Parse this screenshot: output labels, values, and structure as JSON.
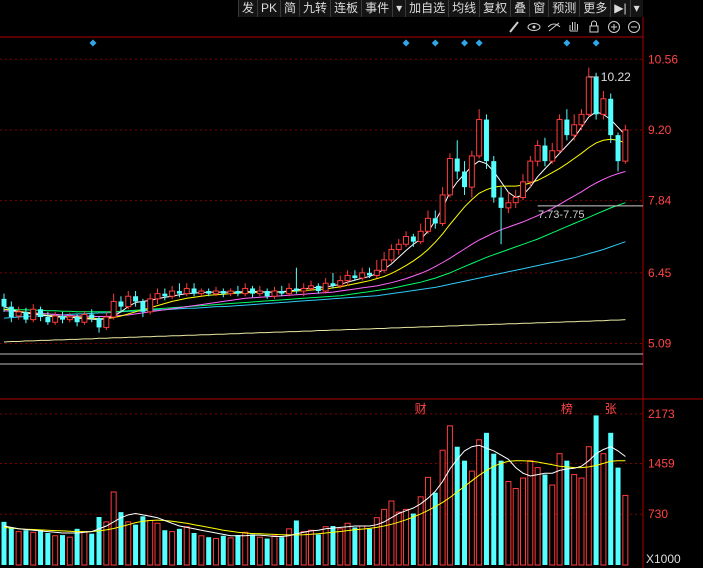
{
  "toolbar": {
    "items": [
      "发",
      "PK",
      "简",
      "九转",
      "连板",
      "事件",
      "▾",
      "加自选",
      "均线",
      "复权",
      "叠",
      "窗",
      "预测",
      "更多"
    ]
  },
  "colors": {
    "up": "#ff3b3b",
    "down": "#54ffff",
    "grid": "#7a0000",
    "ma5": "#ffffff",
    "ma10": "#ffff00",
    "ma20": "#ff66ff",
    "ma30": "#00ff66",
    "ma60": "#2ecbf5",
    "ma120": "#e8e8a0",
    "axis_text": "#ff4444",
    "marker": "#2fa6e8"
  },
  "chart_data": {
    "type": "candlestick",
    "price_axis": {
      "ticks": [
        10.56,
        9.2,
        7.84,
        6.45,
        5.09
      ],
      "ylim": [
        4.6,
        10.95
      ]
    },
    "volume_axis": {
      "ticks": [
        2173,
        1459,
        730
      ],
      "unit_label": "X1000",
      "ylim": [
        0,
        2300
      ]
    },
    "high_label": "10.22",
    "range_label": "7.73-7.75",
    "reference_line": 7.74,
    "event_flags": [
      {
        "index": 57,
        "text": "财"
      },
      {
        "index": 77,
        "text": "榜"
      },
      {
        "index": 83,
        "text": "张"
      }
    ],
    "markers": [
      16,
      55,
      59,
      63,
      65,
      77,
      81
    ],
    "candles": [
      [
        5.95,
        5.8,
        6.05,
        5.7,
        620
      ],
      [
        5.8,
        5.6,
        5.9,
        5.5,
        540
      ],
      [
        5.62,
        5.7,
        5.8,
        5.55,
        480
      ],
      [
        5.7,
        5.55,
        5.78,
        5.48,
        500
      ],
      [
        5.55,
        5.75,
        5.85,
        5.5,
        470
      ],
      [
        5.75,
        5.6,
        5.8,
        5.52,
        510
      ],
      [
        5.6,
        5.5,
        5.7,
        5.45,
        460
      ],
      [
        5.5,
        5.62,
        5.7,
        5.45,
        420
      ],
      [
        5.62,
        5.55,
        5.7,
        5.48,
        430
      ],
      [
        5.55,
        5.6,
        5.68,
        5.5,
        400
      ],
      [
        5.6,
        5.5,
        5.65,
        5.42,
        520
      ],
      [
        5.5,
        5.65,
        5.72,
        5.45,
        480
      ],
      [
        5.65,
        5.58,
        5.75,
        5.5,
        450
      ],
      [
        5.58,
        5.4,
        5.62,
        5.3,
        690
      ],
      [
        5.4,
        5.6,
        5.7,
        5.35,
        620
      ],
      [
        5.6,
        5.9,
        6.05,
        5.55,
        1050
      ],
      [
        5.9,
        5.8,
        6.0,
        5.7,
        760
      ],
      [
        5.8,
        6.0,
        6.1,
        5.75,
        620
      ],
      [
        6.0,
        5.9,
        6.1,
        5.8,
        580
      ],
      [
        5.9,
        5.7,
        5.95,
        5.6,
        700
      ],
      [
        5.7,
        5.95,
        6.05,
        5.65,
        640
      ],
      [
        5.95,
        6.05,
        6.15,
        5.85,
        600
      ],
      [
        6.05,
        6.0,
        6.15,
        5.92,
        500
      ],
      [
        6.0,
        6.1,
        6.2,
        5.95,
        480
      ],
      [
        6.1,
        6.05,
        6.25,
        5.98,
        520
      ],
      [
        6.05,
        6.15,
        6.25,
        6.0,
        550
      ],
      [
        6.15,
        6.05,
        6.25,
        6.0,
        460
      ],
      [
        6.05,
        6.1,
        6.15,
        6.0,
        420
      ],
      [
        6.1,
        6.05,
        6.15,
        6.0,
        400
      ],
      [
        6.05,
        6.1,
        6.18,
        6.0,
        380
      ],
      [
        6.1,
        6.05,
        6.15,
        5.98,
        420
      ],
      [
        6.05,
        6.1,
        6.15,
        6.0,
        390
      ],
      [
        6.1,
        6.05,
        6.2,
        6.0,
        430
      ],
      [
        6.05,
        6.15,
        6.25,
        6.0,
        470
      ],
      [
        6.15,
        6.05,
        6.2,
        5.98,
        440
      ],
      [
        6.05,
        6.1,
        6.2,
        6.0,
        400
      ],
      [
        6.1,
        6.0,
        6.15,
        5.95,
        380
      ],
      [
        6.0,
        6.1,
        6.18,
        5.95,
        420
      ],
      [
        6.1,
        6.05,
        6.2,
        6.0,
        400
      ],
      [
        6.05,
        6.15,
        6.25,
        6.0,
        520
      ],
      [
        6.15,
        6.1,
        6.55,
        6.05,
        640
      ],
      [
        6.1,
        6.15,
        6.25,
        6.0,
        480
      ],
      [
        6.15,
        6.2,
        6.3,
        6.1,
        500
      ],
      [
        6.2,
        6.1,
        6.25,
        6.05,
        440
      ],
      [
        6.1,
        6.25,
        6.35,
        6.05,
        550
      ],
      [
        6.25,
        6.2,
        6.45,
        6.15,
        560
      ],
      [
        6.2,
        6.3,
        6.4,
        6.15,
        520
      ],
      [
        6.3,
        6.4,
        6.5,
        6.2,
        600
      ],
      [
        6.4,
        6.35,
        6.5,
        6.3,
        540
      ],
      [
        6.35,
        6.45,
        6.55,
        6.3,
        560
      ],
      [
        6.45,
        6.4,
        6.55,
        6.35,
        520
      ],
      [
        6.4,
        6.5,
        6.7,
        6.35,
        680
      ],
      [
        6.5,
        6.7,
        6.85,
        6.45,
        800
      ],
      [
        6.7,
        6.9,
        7.0,
        6.65,
        920
      ],
      [
        6.9,
        7.0,
        7.1,
        6.8,
        760
      ],
      [
        7.0,
        7.15,
        7.25,
        6.95,
        800
      ],
      [
        7.15,
        7.05,
        7.2,
        6.95,
        740
      ],
      [
        7.05,
        7.25,
        7.4,
        7.0,
        980
      ],
      [
        7.25,
        7.5,
        7.65,
        7.2,
        1260
      ],
      [
        7.5,
        7.4,
        7.65,
        7.3,
        1040
      ],
      [
        7.4,
        7.95,
        8.1,
        7.35,
        1650
      ],
      [
        7.95,
        8.65,
        8.75,
        7.9,
        2000
      ],
      [
        8.65,
        8.4,
        9.0,
        8.25,
        1700
      ],
      [
        8.4,
        8.1,
        8.6,
        7.95,
        1500
      ],
      [
        8.1,
        8.7,
        8.8,
        7.9,
        1350
      ],
      [
        8.7,
        9.4,
        9.6,
        8.65,
        1800
      ],
      [
        9.4,
        8.6,
        9.5,
        8.45,
        1900
      ],
      [
        8.6,
        7.9,
        8.7,
        7.8,
        1600
      ],
      [
        7.9,
        7.7,
        8.1,
        7.0,
        1500
      ],
      [
        7.7,
        7.8,
        8.0,
        7.6,
        1200
      ],
      [
        7.8,
        7.9,
        8.05,
        7.7,
        1100
      ],
      [
        7.9,
        8.2,
        8.35,
        7.85,
        1250
      ],
      [
        8.2,
        8.6,
        8.7,
        8.1,
        1500
      ],
      [
        8.6,
        8.9,
        9.0,
        8.5,
        1400
      ],
      [
        8.9,
        8.6,
        9.05,
        8.5,
        1300
      ],
      [
        8.6,
        8.8,
        8.95,
        8.55,
        1150
      ],
      [
        8.8,
        9.4,
        9.5,
        8.75,
        1600
      ],
      [
        9.4,
        9.1,
        9.6,
        9.0,
        1500
      ],
      [
        9.1,
        9.3,
        9.5,
        9.0,
        1300
      ],
      [
        9.3,
        9.5,
        9.6,
        9.2,
        1250
      ],
      [
        9.5,
        10.22,
        10.4,
        9.45,
        1700
      ],
      [
        10.22,
        9.5,
        10.3,
        9.4,
        2150
      ],
      [
        9.5,
        9.8,
        9.95,
        9.4,
        1600
      ],
      [
        9.8,
        9.1,
        9.9,
        8.95,
        1900
      ],
      [
        9.1,
        8.6,
        9.15,
        8.4,
        1400
      ],
      [
        8.6,
        9.2,
        9.3,
        8.55,
        1000
      ]
    ],
    "ma_series": {
      "ma5": [
        5.8,
        5.75,
        5.7,
        5.68,
        5.66,
        5.64,
        5.62,
        5.6,
        5.6,
        5.6,
        5.58,
        5.57,
        5.56,
        5.55,
        5.57,
        5.62,
        5.7,
        5.8,
        5.88,
        5.9,
        5.92,
        5.95,
        5.98,
        6.0,
        6.03,
        6.05,
        6.06,
        6.07,
        6.08,
        6.08,
        6.08,
        6.08,
        6.08,
        6.09,
        6.09,
        6.09,
        6.08,
        6.08,
        6.09,
        6.1,
        6.12,
        6.14,
        6.16,
        6.17,
        6.18,
        6.2,
        6.23,
        6.27,
        6.31,
        6.35,
        6.38,
        6.44,
        6.52,
        6.62,
        6.75,
        6.88,
        7.0,
        7.1,
        7.25,
        7.45,
        7.7,
        8.0,
        8.2,
        8.35,
        8.5,
        8.6,
        8.55,
        8.4,
        8.2,
        8.0,
        7.9,
        7.95,
        8.1,
        8.3,
        8.45,
        8.6,
        8.75,
        8.9,
        9.05,
        9.25,
        9.45,
        9.55,
        9.5,
        9.4,
        9.25,
        9.1
      ],
      "ma10": [
        5.75,
        5.73,
        5.71,
        5.69,
        5.67,
        5.65,
        5.63,
        5.62,
        5.61,
        5.6,
        5.6,
        5.59,
        5.58,
        5.57,
        5.57,
        5.59,
        5.62,
        5.66,
        5.7,
        5.74,
        5.78,
        5.82,
        5.86,
        5.9,
        5.93,
        5.96,
        5.98,
        6.0,
        6.02,
        6.03,
        6.04,
        6.05,
        6.06,
        6.07,
        6.07,
        6.08,
        6.08,
        6.08,
        6.08,
        6.09,
        6.1,
        6.11,
        6.12,
        6.13,
        6.14,
        6.16,
        6.18,
        6.21,
        6.24,
        6.27,
        6.3,
        6.34,
        6.38,
        6.44,
        6.51,
        6.59,
        6.68,
        6.78,
        6.9,
        7.04,
        7.2,
        7.38,
        7.55,
        7.72,
        7.86,
        7.98,
        8.05,
        8.1,
        8.12,
        8.12,
        8.12,
        8.14,
        8.18,
        8.23,
        8.3,
        8.38,
        8.46,
        8.55,
        8.65,
        8.75,
        8.86,
        8.95,
        9.0,
        9.02,
        9.0,
        8.95
      ],
      "ma20": [
        5.72,
        5.71,
        5.7,
        5.69,
        5.68,
        5.67,
        5.66,
        5.65,
        5.64,
        5.63,
        5.62,
        5.62,
        5.61,
        5.61,
        5.61,
        5.62,
        5.63,
        5.64,
        5.66,
        5.68,
        5.7,
        5.72,
        5.74,
        5.76,
        5.78,
        5.8,
        5.82,
        5.84,
        5.86,
        5.88,
        5.9,
        5.92,
        5.94,
        5.96,
        5.97,
        5.98,
        5.99,
        6.0,
        6.01,
        6.02,
        6.03,
        6.04,
        6.05,
        6.06,
        6.07,
        6.08,
        6.1,
        6.12,
        6.14,
        6.16,
        6.18,
        6.2,
        6.23,
        6.26,
        6.3,
        6.34,
        6.39,
        6.44,
        6.5,
        6.57,
        6.65,
        6.73,
        6.82,
        6.91,
        7.0,
        7.08,
        7.15,
        7.22,
        7.28,
        7.33,
        7.38,
        7.43,
        7.49,
        7.55,
        7.62,
        7.69,
        7.77,
        7.85,
        7.93,
        8.01,
        8.1,
        8.18,
        8.25,
        8.31,
        8.36,
        8.4
      ],
      "ma30": [
        5.75,
        5.75,
        5.74,
        5.74,
        5.73,
        5.73,
        5.72,
        5.72,
        5.71,
        5.71,
        5.7,
        5.7,
        5.7,
        5.7,
        5.7,
        5.7,
        5.71,
        5.72,
        5.73,
        5.74,
        5.75,
        5.76,
        5.77,
        5.78,
        5.79,
        5.8,
        5.81,
        5.82,
        5.83,
        5.84,
        5.85,
        5.86,
        5.87,
        5.88,
        5.89,
        5.9,
        5.91,
        5.92,
        5.93,
        5.94,
        5.95,
        5.96,
        5.97,
        5.98,
        5.99,
        6.0,
        6.01,
        6.03,
        6.05,
        6.07,
        6.09,
        6.11,
        6.13,
        6.15,
        6.18,
        6.21,
        6.24,
        6.27,
        6.31,
        6.35,
        6.4,
        6.45,
        6.51,
        6.57,
        6.63,
        6.69,
        6.75,
        6.8,
        6.85,
        6.9,
        6.95,
        7.0,
        7.05,
        7.1,
        7.16,
        7.22,
        7.28,
        7.34,
        7.4,
        7.46,
        7.52,
        7.58,
        7.64,
        7.7,
        7.75,
        7.8
      ],
      "ma60": [
        5.58,
        5.59,
        5.6,
        5.61,
        5.62,
        5.62,
        5.63,
        5.64,
        5.64,
        5.65,
        5.66,
        5.66,
        5.67,
        5.68,
        5.68,
        5.69,
        5.7,
        5.71,
        5.71,
        5.72,
        5.73,
        5.74,
        5.74,
        5.75,
        5.76,
        5.77,
        5.77,
        5.78,
        5.79,
        5.8,
        5.8,
        5.81,
        5.82,
        5.83,
        5.84,
        5.85,
        5.86,
        5.87,
        5.88,
        5.89,
        5.9,
        5.91,
        5.92,
        5.93,
        5.94,
        5.95,
        5.96,
        5.97,
        5.98,
        5.99,
        6.0,
        6.01,
        6.03,
        6.05,
        6.07,
        6.09,
        6.11,
        6.13,
        6.15,
        6.17,
        6.2,
        6.23,
        6.26,
        6.29,
        6.32,
        6.35,
        6.38,
        6.41,
        6.44,
        6.47,
        6.5,
        6.53,
        6.56,
        6.59,
        6.62,
        6.65,
        6.68,
        6.71,
        6.74,
        6.78,
        6.82,
        6.86,
        6.9,
        6.95,
        7.0,
        7.05
      ],
      "ma120": [
        5.12,
        5.13,
        5.13,
        5.14,
        5.14,
        5.15,
        5.15,
        5.16,
        5.16,
        5.17,
        5.17,
        5.18,
        5.18,
        5.19,
        5.19,
        5.2,
        5.2,
        5.21,
        5.21,
        5.22,
        5.22,
        5.23,
        5.23,
        5.24,
        5.24,
        5.25,
        5.25,
        5.26,
        5.26,
        5.27,
        5.27,
        5.28,
        5.28,
        5.29,
        5.29,
        5.3,
        5.3,
        5.31,
        5.31,
        5.32,
        5.32,
        5.33,
        5.33,
        5.34,
        5.34,
        5.35,
        5.35,
        5.36,
        5.36,
        5.37,
        5.37,
        5.38,
        5.38,
        5.39,
        5.39,
        5.4,
        5.4,
        5.41,
        5.41,
        5.42,
        5.42,
        5.43,
        5.43,
        5.44,
        5.44,
        5.45,
        5.45,
        5.46,
        5.46,
        5.47,
        5.47,
        5.48,
        5.48,
        5.49,
        5.49,
        5.5,
        5.5,
        5.51,
        5.51,
        5.52,
        5.52,
        5.53,
        5.53,
        5.54,
        5.54,
        5.55
      ]
    },
    "vol_ma": {
      "vma5": [
        560,
        540,
        520,
        510,
        500,
        490,
        480,
        470,
        460,
        460,
        460,
        470,
        480,
        520,
        560,
        620,
        680,
        720,
        740,
        720,
        700,
        680,
        640,
        600,
        560,
        540,
        520,
        500,
        480,
        460,
        440,
        420,
        420,
        420,
        430,
        430,
        420,
        410,
        410,
        420,
        450,
        470,
        490,
        500,
        520,
        530,
        540,
        550,
        560,
        560,
        560,
        580,
        620,
        680,
        740,
        780,
        820,
        880,
        960,
        1060,
        1200,
        1380,
        1520,
        1640,
        1700,
        1720,
        1680,
        1640,
        1580,
        1520,
        1400,
        1320,
        1280,
        1300,
        1320,
        1320,
        1360,
        1380,
        1390,
        1420,
        1500,
        1600,
        1660,
        1700,
        1640,
        1560
      ],
      "vma10": [
        540,
        530,
        520,
        515,
        510,
        505,
        500,
        495,
        490,
        485,
        480,
        480,
        482,
        490,
        505,
        525,
        550,
        580,
        610,
        630,
        640,
        645,
        640,
        630,
        615,
        600,
        580,
        560,
        540,
        520,
        500,
        485,
        470,
        460,
        452,
        448,
        444,
        440,
        436,
        432,
        432,
        436,
        442,
        450,
        460,
        470,
        482,
        494,
        506,
        516,
        526,
        540,
        560,
        585,
        615,
        650,
        690,
        735,
        785,
        840,
        900,
        970,
        1050,
        1130,
        1210,
        1290,
        1360,
        1420,
        1460,
        1490,
        1500,
        1500,
        1490,
        1480,
        1460,
        1440,
        1420,
        1410,
        1400,
        1400,
        1410,
        1430,
        1460,
        1490,
        1500,
        1500
      ]
    }
  }
}
